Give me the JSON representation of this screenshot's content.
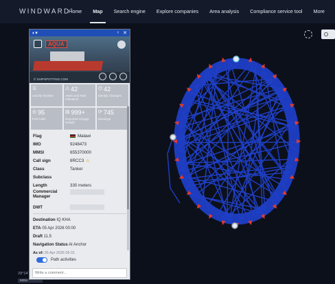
{
  "app": {
    "brand": "WINDWARD",
    "brand_mark": "®"
  },
  "nav": {
    "items": [
      {
        "label": "Home"
      },
      {
        "label": "Map",
        "active": true
      },
      {
        "label": "Search engine"
      },
      {
        "label": "Explore companies"
      },
      {
        "label": "Area analysis"
      },
      {
        "label": "Compliance service tool"
      },
      {
        "label": "More"
      }
    ]
  },
  "colors": {
    "track": "#1f3fc6",
    "arrow": "#e2392e",
    "panel_header": "#1f4fb6",
    "toggle": "#2f6be0"
  },
  "vessel": {
    "name": "AQUA",
    "photo_credit": "© SHIPSPOTTING.COM",
    "stats": [
      {
        "icon": "list-icon",
        "value": "",
        "label": "Activity timeline"
      },
      {
        "icon": "alert-icon",
        "value": "42",
        "label": "Alerts and Risk Indicators"
      },
      {
        "icon": "identity-icon",
        "value": "42",
        "label": "Identity Changes"
      },
      {
        "icon": "port-icon",
        "value": "95",
        "label": "Port Calls"
      },
      {
        "icon": "report-icon",
        "value": "999+",
        "label": "Reported Voyage Details"
      },
      {
        "icon": "meeting-icon",
        "value": "745",
        "label": "Meetings"
      }
    ],
    "details": [
      {
        "key": "Flag",
        "value": "Malawi",
        "flag": true
      },
      {
        "key": "IMO",
        "value": "9248473"
      },
      {
        "key": "MMSI",
        "value": "655370000"
      },
      {
        "key": "Call sign",
        "value": "8RCC3",
        "warn": true
      },
      {
        "key": "Class",
        "value": "Tanker"
      },
      {
        "key": "Subclass",
        "value": ""
      },
      {
        "key": "Length",
        "value": "330 meters"
      },
      {
        "key": "Commercial Manager",
        "value": "",
        "redacted": true
      },
      {
        "key": "DWT",
        "value": "",
        "redacted": true
      }
    ],
    "voyage": {
      "destination_label": "Destination",
      "destination": "IQ KHA",
      "eta_label": "ETA",
      "eta": "05 Apr 2026 00:00",
      "draft_label": "Draft",
      "draft": "11.5",
      "nav_status_label": "Navigation Status",
      "nav_status": "At Anchor",
      "as_of_label": "As of:",
      "as_of": "26 Apr 2026 05:31"
    },
    "path_toggle_label": "Path activities",
    "comment_placeholder": "Write a comment..."
  },
  "map": {
    "coords": "29°14'",
    "scale": "500m"
  }
}
